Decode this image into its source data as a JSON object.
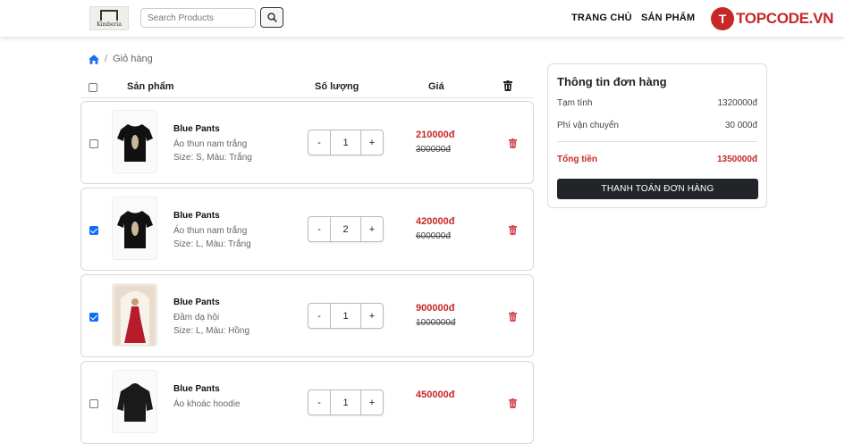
{
  "header": {
    "logo_text": "Kimberia",
    "search_placeholder": "Search Products",
    "nav": [
      "TRANG CHỦ",
      "SẢN PHẨM"
    ],
    "brand": "TOPCODE.VN"
  },
  "breadcrumb": {
    "current": "Giỏ hàng"
  },
  "table": {
    "col_product": "Sản phẩm",
    "col_qty": "Số lượng",
    "col_price": "Giá"
  },
  "items": [
    {
      "name": "Blue Pants",
      "desc": "Áo thun nam trắng",
      "meta": "Size: S, Màu: Trắng",
      "qty": "1",
      "price": "210000đ",
      "old_price": "300000đ",
      "checked": false
    },
    {
      "name": "Blue Pants",
      "desc": "Áo thun nam trắng",
      "meta": "Size: L, Màu: Trắng",
      "qty": "2",
      "price": "420000đ",
      "old_price": "600000đ",
      "checked": true
    },
    {
      "name": "Blue Pants",
      "desc": "Đầm dạ hội",
      "meta": "Size: L, Màu: Hồng",
      "qty": "1",
      "price": "900000đ",
      "old_price": "1000000đ",
      "checked": true
    },
    {
      "name": "Blue Pants",
      "desc": "Áo khoác hoodie",
      "meta": "",
      "qty": "1",
      "price": "450000đ",
      "old_price": "",
      "checked": false
    }
  ],
  "qty_minus": "-",
  "qty_plus": "+",
  "summary": {
    "title": "Thông tin đơn hàng",
    "subtotal_label": "Tạm tính",
    "subtotal_value": "1320000đ",
    "shipping_label": "Phí vận chuyển",
    "shipping_value": "30 000đ",
    "total_label": "Tổng tiền",
    "total_value": "1350000đ",
    "checkout_label": "THANH TOÁN ĐƠN HÀNG"
  },
  "colors": {
    "accent": "#c62828",
    "dark": "#212529",
    "link": "#0d6efd"
  }
}
